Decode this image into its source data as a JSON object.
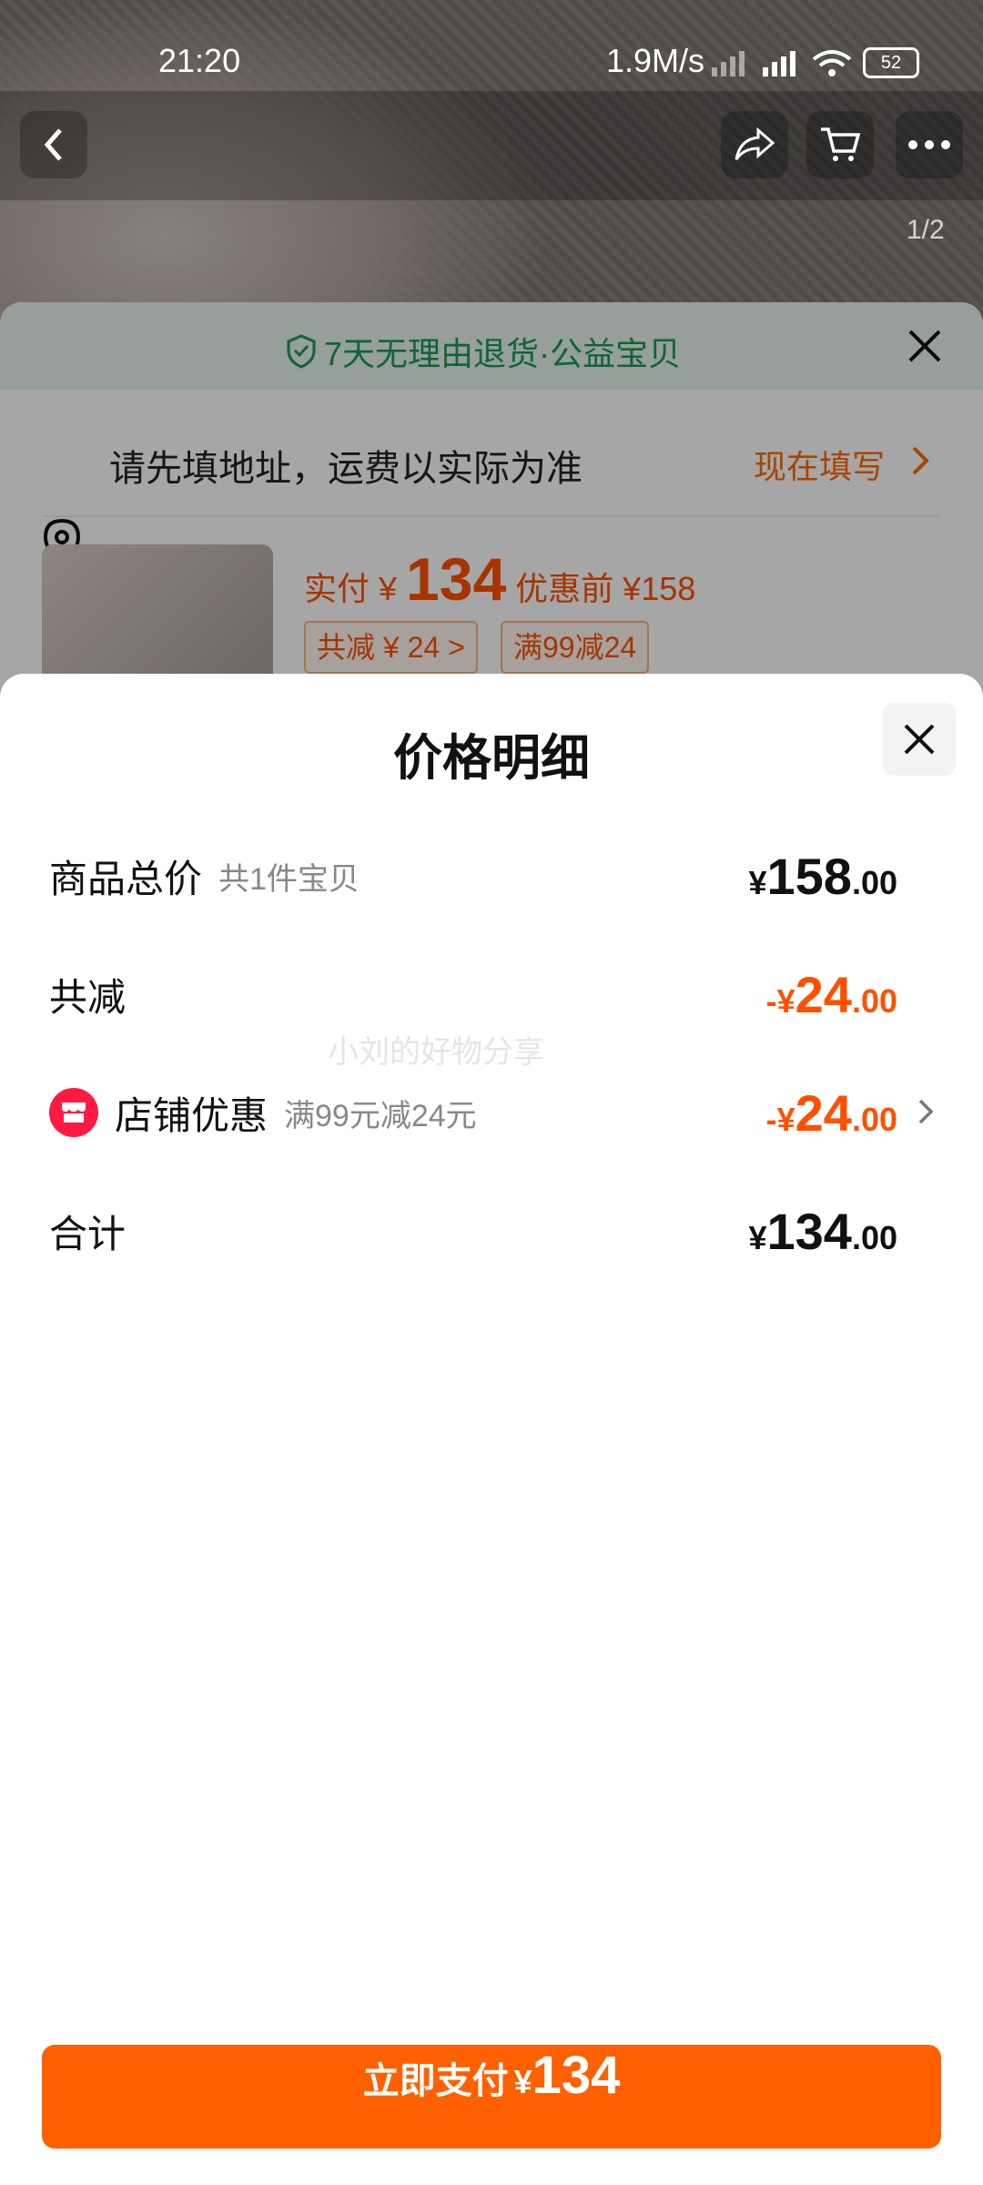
{
  "status_bar": {
    "time": "21:20",
    "network_speed": "1.9M/s",
    "battery": "52"
  },
  "product_header": {
    "page_indicator": "1/2"
  },
  "order_sheet": {
    "return_policy": "7天无理由退货·公益宝贝",
    "address_prompt": "请先填地址，运费以实际为准",
    "fill_now": "现在填写",
    "paid_label": "实付",
    "paid_currency": "¥",
    "paid_value": "134",
    "original_price": "优惠前 ¥158",
    "tag_total_discount": "共减 ¥ 24 >",
    "tag_promo": "满99减24"
  },
  "price_detail": {
    "title": "价格明细",
    "rows": [
      {
        "label": "商品总价",
        "sub": "共1件宝贝",
        "prefix": "",
        "symbol": "¥",
        "int": "158",
        "dec": ".00"
      },
      {
        "label": "共减",
        "sub": "",
        "prefix": "-",
        "symbol": "¥",
        "int": "24",
        "dec": ".00"
      },
      {
        "label": "店铺优惠",
        "sub": "满99元减24元",
        "prefix": "-",
        "symbol": "¥",
        "int": "24",
        "dec": ".00"
      },
      {
        "label": "合计",
        "sub": "",
        "prefix": "",
        "symbol": "¥",
        "int": "134",
        "dec": ".00"
      }
    ],
    "watermark": "小刘的好物分享"
  },
  "pay_button": {
    "label": "立即支付",
    "symbol": "¥",
    "amount": "134"
  },
  "colors": {
    "accent": "#ff6000",
    "discount": "#ff5000",
    "shop_icon": "#ff1a44"
  }
}
